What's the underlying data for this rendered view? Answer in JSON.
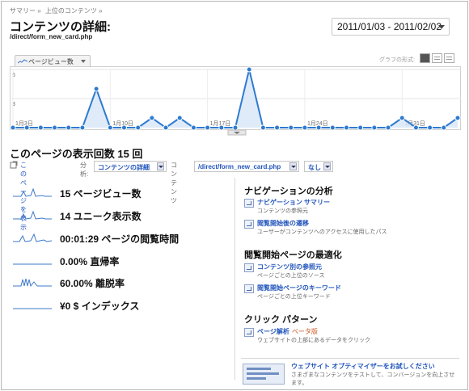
{
  "breadcrumb": [
    "サマリー »",
    "上位のコンテンツ »"
  ],
  "page_title": "コンテンツの詳細:",
  "page_path": "/direct/form_new_card.php",
  "date_range": "2011/01/03 - 2011/02/02",
  "chart": {
    "metric_tab": "ページビュー数",
    "graph_format_label": "グラフの形式:",
    "y_ticks": [
      "6",
      "3"
    ],
    "x_ticks": [
      "1月3日",
      "1月10日",
      "1月17日",
      "1月24日",
      "1月31日"
    ]
  },
  "chart_data": {
    "type": "line",
    "title": "",
    "series": [
      {
        "name": "ページビュー数",
        "values": [
          0,
          0,
          0,
          0,
          0,
          0,
          4,
          0,
          0,
          0,
          1,
          0,
          1,
          0,
          0,
          0,
          0,
          6,
          0,
          0,
          0,
          0,
          0,
          0,
          0,
          0,
          0,
          0,
          1,
          0,
          0,
          0,
          1
        ]
      }
    ],
    "ylim": [
      0,
      6
    ],
    "x_tick_labels": [
      "1月3日",
      "1月10日",
      "1月17日",
      "1月24日",
      "1月31日"
    ],
    "accent": "#2f7bd0"
  },
  "views_heading": "このページの表示回数 15 回",
  "controls": {
    "view_page": "このページを表示",
    "analysis_label": "分析:",
    "analysis_value": "コンテンツの詳細",
    "content_label": "コンテンツ",
    "content_value": "/direct/form_new_card.php",
    "none_value": "なし"
  },
  "stats": [
    {
      "text": "15 ページビュー数"
    },
    {
      "text": "14 ユニーク表示数"
    },
    {
      "text": "00:01:29 ページの閲覧時間"
    },
    {
      "text": "0.00% 直帰率"
    },
    {
      "text": "60.00% 離脱率"
    },
    {
      "text": "¥0 $ インデックス"
    }
  ],
  "nav_analysis": {
    "title": "ナビゲーションの分析",
    "items": [
      {
        "link": "ナビゲーション サマリー",
        "desc": "コンテンツの参照元"
      },
      {
        "link": "閲覧開始後の遷移",
        "desc": "ユーザーがコンテンツへのアクセスに使用したパス"
      }
    ]
  },
  "landing_optim": {
    "title": "閲覧開始ページの最適化",
    "items": [
      {
        "link": "コンテンツ別の参照元",
        "desc": "ページごとの上位のソース"
      },
      {
        "link": "閲覧開始ページのキーワード",
        "desc": "ページごとの上位キーワード"
      }
    ]
  },
  "click_pattern": {
    "title": "クリック パターン",
    "link": "ページ解析",
    "beta": "ベータ版",
    "desc": "ウェブサイトの上部にあるデータをクリック"
  },
  "optimizer": {
    "link": "ウェブサイト オプティマイザーをお試しください",
    "desc": "さまざまなコンテンツをテストして、コンバージョンを向上させ",
    "desc2": "ます。"
  }
}
